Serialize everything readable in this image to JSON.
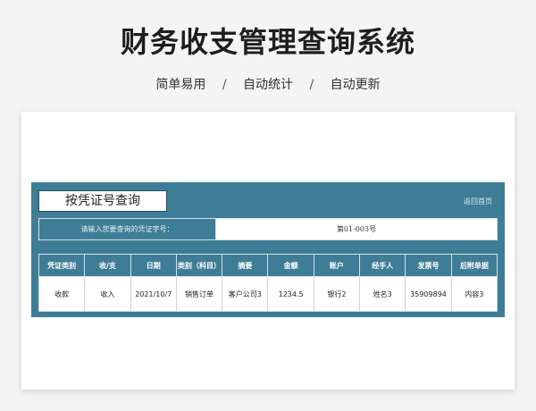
{
  "header": {
    "title": "财务收支管理查询系统",
    "features": [
      "简单易用",
      "自动统计",
      "自动更新"
    ],
    "separator": "/"
  },
  "panel": {
    "query_title": "按凭证号查询",
    "back_link": "返回首页",
    "search": {
      "label": "请输入您要查询的凭证字号：",
      "value": "第01-003号"
    }
  },
  "table": {
    "columns": [
      "凭证类别",
      "收/支",
      "日期",
      "类别（科目）",
      "摘要",
      "金额",
      "账户",
      "经手人",
      "发票号",
      "后附单据"
    ],
    "rows": [
      [
        "收款",
        "收入",
        "2021/10/7",
        "销售订单",
        "客户公司3",
        "1234.5",
        "银行2",
        "姓名3",
        "35909894",
        "内容3"
      ]
    ]
  },
  "colors": {
    "panel_bg": "#3f7d96",
    "page_bg": "#f4f4f4",
    "title_text": "#1e1e1e"
  }
}
